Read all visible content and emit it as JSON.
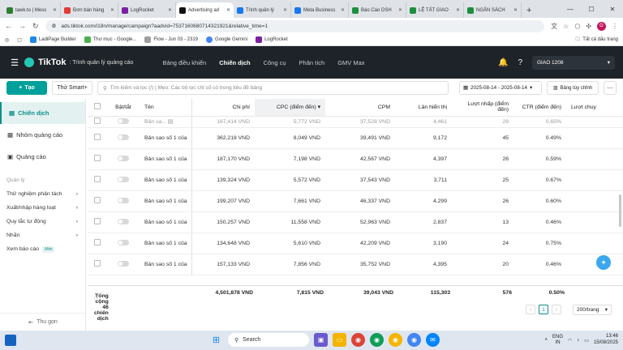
{
  "browser": {
    "tabs": [
      {
        "label": "tawk.to | Mess",
        "color": "#2e7d32",
        "active": false
      },
      {
        "label": "Đơn bán hàng",
        "color": "#e53935",
        "active": false
      },
      {
        "label": "LogRocket",
        "color": "#7b1fa2",
        "active": false
      },
      {
        "label": "Advertising ad",
        "color": "#111111",
        "active": true
      },
      {
        "label": "Trình quản lý",
        "color": "#1877f2",
        "active": false
      },
      {
        "label": "Meta Business",
        "color": "#1877f2",
        "active": false
      },
      {
        "label": "Báo Cáo DSH",
        "color": "#1e8e3e",
        "active": false
      },
      {
        "label": "LỆ TẤT GIAO",
        "color": "#1e8e3e",
        "active": false
      },
      {
        "label": "NGÂN SÁCH",
        "color": "#1e8e3e",
        "active": false
      }
    ],
    "url": "ads.tiktok.com/i18n/manage/campaign?aadvid=7537160680714321921&relative_time=1",
    "profile_initial": "G",
    "bookmarks": [
      "LadiPage Builder",
      "Thư mục - Google...",
      "Flow - Jun 03 - 2319",
      "Google Gemini",
      "LogRocket"
    ],
    "all_bookmarks": "Tất cả dấu trang"
  },
  "app": {
    "brand": "TikTok",
    "subtitle": ": Trình quản lý quảng cáo",
    "nav": [
      "Bảng điều khiển",
      "Chiến dịch",
      "Công cụ",
      "Phân tích",
      "GMV Max"
    ],
    "active_nav": "Chiến dịch",
    "account": "GIAO 1208"
  },
  "toolbar": {
    "create_label": "Tạo",
    "smart_label": "Thử Smart+",
    "search_placeholder": "Tìm kiếm và lọc (/) | Mẹo: Các bộ lọc chỉ số có trong tiêu đề bảng",
    "date_range": "2025-08-14 - 2025-08-14",
    "customize_label": "Bảng tùy chỉnh"
  },
  "sidebar": {
    "items": [
      {
        "label": "Chiến dịch",
        "active": true
      },
      {
        "label": "Nhóm quảng cáo",
        "active": false
      },
      {
        "label": "Quảng cáo",
        "active": false
      }
    ],
    "manage_label": "Quản lý",
    "links": [
      {
        "label": "Thử nghiệm phân tách",
        "arrow": "›"
      },
      {
        "label": "Xuất/nhập hàng loạt",
        "arrow": "›"
      },
      {
        "label": "Quy tắc tự động",
        "arrow": "›"
      },
      {
        "label": "Nhãn",
        "arrow": "›"
      },
      {
        "label": "Xem báo cáo",
        "badge": "Mới"
      }
    ],
    "collapse_label": "Thu gọn"
  },
  "table": {
    "headers": {
      "toggle": "Bật/tắt",
      "name": "Tên",
      "spend": "Chi phí",
      "cpc": "CPC (điểm đến)",
      "cpm": "CPM",
      "impressions": "Lần hiển thị",
      "clicks": "Lượt nhấp (điểm đến)",
      "ctr": "CTR (điểm đến)",
      "conv": "Lượt chuy"
    },
    "partial_top": {
      "name": "Bản sa...",
      "spend": "167,414 VND",
      "cpc": "5,772 VND",
      "cpm": "37,528 VND",
      "impressions": "4,461",
      "clicks": "29",
      "ctr": "0.65%"
    },
    "rows": [
      {
        "name": "Bản sao số 1 của",
        "spend": "362,218 VND",
        "cpc": "8,049 VND",
        "cpm": "39,491 VND",
        "impressions": "9,172",
        "clicks": "45",
        "ctr": "0.49%"
      },
      {
        "name": "Bản sao số 1 của",
        "spend": "187,170 VND",
        "cpc": "7,198 VND",
        "cpm": "42,567 VND",
        "impressions": "4,397",
        "clicks": "26",
        "ctr": "0.59%"
      },
      {
        "name": "Bản sao số 1 của",
        "spend": "139,324 VND",
        "cpc": "5,572 VND",
        "cpm": "37,543 VND",
        "impressions": "3,711",
        "clicks": "25",
        "ctr": "0.67%"
      },
      {
        "name": "Bản sao số 1 của",
        "spend": "199,207 VND",
        "cpc": "7,661 VND",
        "cpm": "46,337 VND",
        "impressions": "4,299",
        "clicks": "26",
        "ctr": "0.60%"
      },
      {
        "name": "Bản sao số 1 của",
        "spend": "150,257 VND",
        "cpc": "11,558 VND",
        "cpm": "52,963 VND",
        "impressions": "2,837",
        "clicks": "13",
        "ctr": "0.46%"
      },
      {
        "name": "Bản sao số 1 của",
        "spend": "134,648 VND",
        "cpc": "5,610 VND",
        "cpm": "42,209 VND",
        "impressions": "3,190",
        "clicks": "24",
        "ctr": "0.75%"
      },
      {
        "name": "Bản sao số 1 của",
        "spend": "157,133 VND",
        "cpc": "7,856 VND",
        "cpm": "35,752 VND",
        "impressions": "4,395",
        "clicks": "20",
        "ctr": "0.46%"
      }
    ],
    "totals": {
      "label": "Tổng cộng 46 chiến dịch",
      "spend": "4,501,878 VND",
      "cpc": "7,815 VND",
      "cpm": "39,043 VND",
      "impressions": "115,303",
      "clicks": "576",
      "ctr": "0.50%"
    }
  },
  "pager": {
    "page": "1",
    "per_page": "200/trang"
  },
  "taskbar": {
    "search_label": "Search",
    "lang": "ENG",
    "lang2": "IN",
    "time": "13:46",
    "date": "15/08/2025"
  }
}
